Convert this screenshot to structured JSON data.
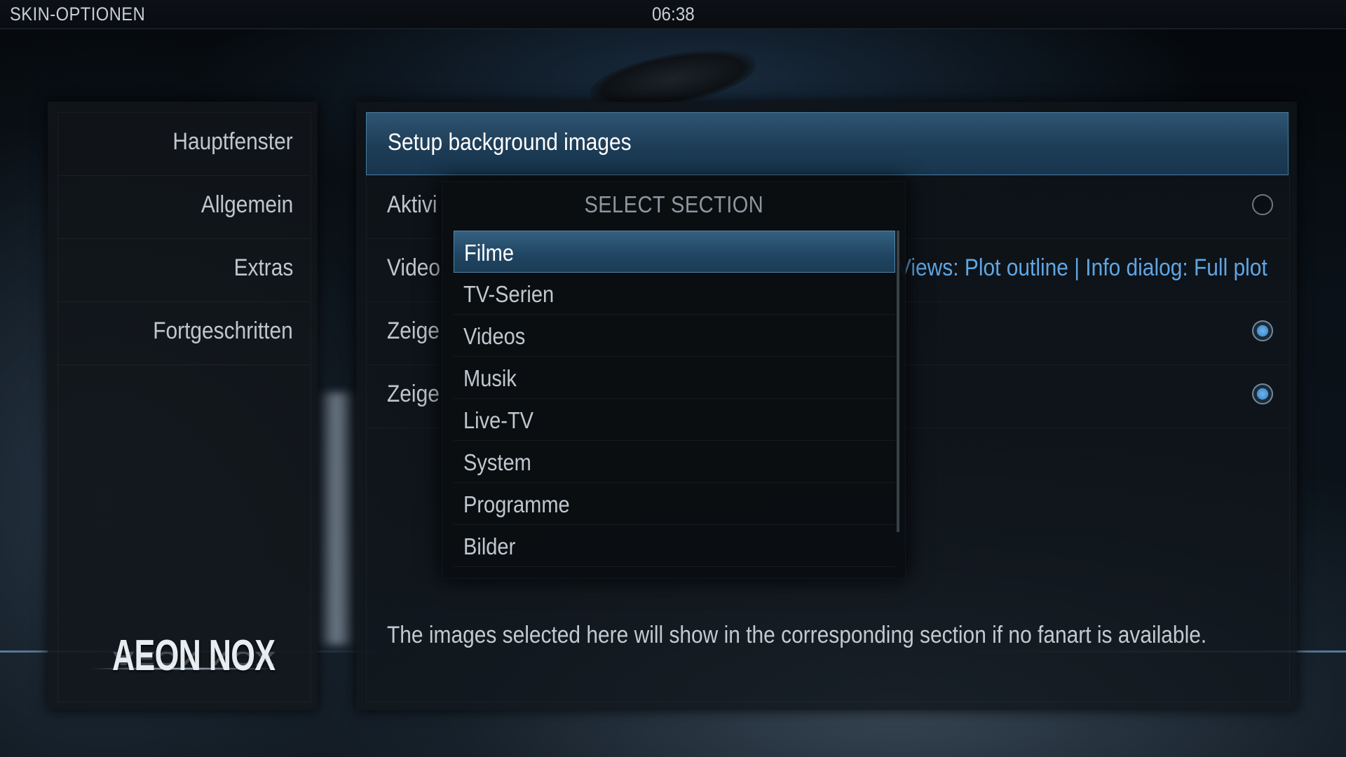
{
  "topbar": {
    "title": "SKIN-OPTIONEN",
    "clock": "06:38"
  },
  "sidebar": {
    "items": [
      {
        "label": "Hauptfenster"
      },
      {
        "label": "Allgemein"
      },
      {
        "label": "Extras"
      },
      {
        "label": "Fortgeschritten"
      }
    ],
    "logo": "AEON NOX"
  },
  "main": {
    "header": "Setup background images",
    "rows": [
      {
        "label": "Aktivi",
        "control": "radio",
        "checked": false
      },
      {
        "label": "Video",
        "value": "Views: Plot outline | Info dialog: Full plot"
      },
      {
        "label": "Zeige",
        "control": "radio",
        "checked": true
      },
      {
        "label": "Zeige",
        "control": "radio",
        "checked": true
      }
    ],
    "footer": "The images selected here will show in the corresponding section if no fanart is available."
  },
  "dialog": {
    "title": "SELECT SECTION",
    "items": [
      {
        "label": "Filme",
        "selected": true
      },
      {
        "label": "TV-Serien"
      },
      {
        "label": "Videos"
      },
      {
        "label": "Musik"
      },
      {
        "label": "Live-TV"
      },
      {
        "label": "System"
      },
      {
        "label": "Programme"
      },
      {
        "label": "Bilder"
      }
    ]
  },
  "colors": {
    "accent": "#5fa6e3",
    "selection": "#1f4562",
    "text": "#bfc6cd"
  }
}
